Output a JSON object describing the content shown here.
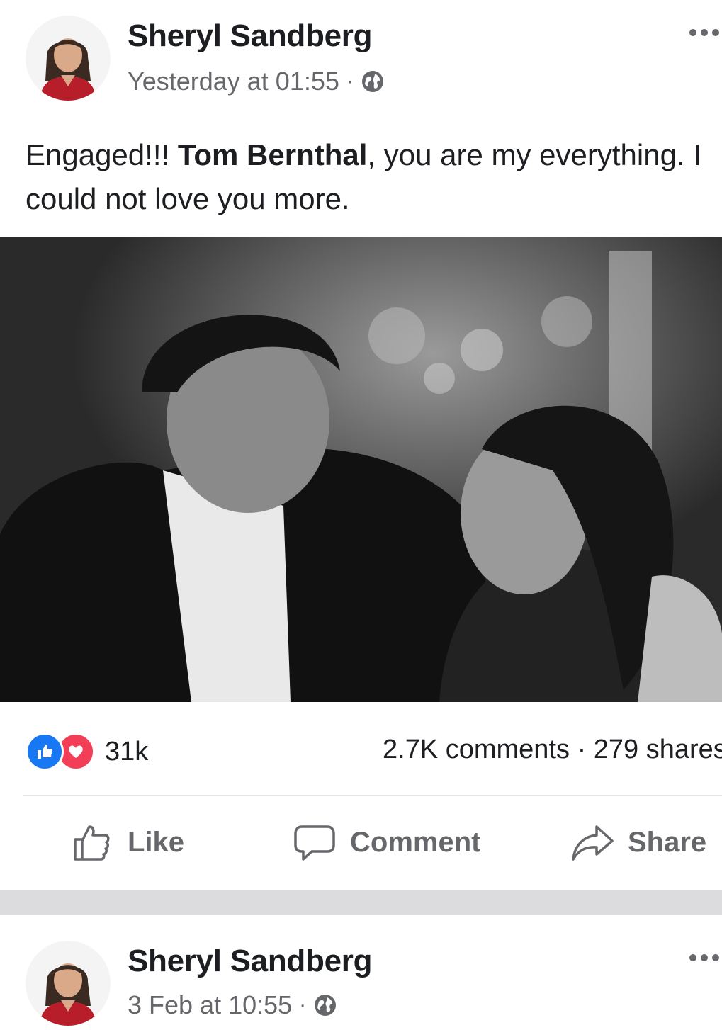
{
  "posts": [
    {
      "author": "Sheryl Sandberg",
      "time": "Yesterday at 01:55",
      "separator": "·",
      "text_part1": "Engaged!!! ",
      "text_mention": "Tom Bernthal",
      "text_part2": ", you are my everything. I could not love you more.",
      "reaction_count": "31k",
      "comments": "2.7K comments",
      "stats_separator": "·",
      "shares": "279 shares",
      "actions": {
        "like": "Like",
        "comment": "Comment",
        "share": "Share"
      }
    },
    {
      "author": "Sheryl Sandberg",
      "time": "3 Feb at 10:55",
      "separator": "·"
    }
  ],
  "colors": {
    "like_blue": "#1877f2",
    "love_red": "#f33e58",
    "secondary_text": "#65676b",
    "separator_gray": "#dcdcdf"
  },
  "icons": [
    "more-icon",
    "globe-icon",
    "like-reaction-icon",
    "love-reaction-icon",
    "thumbs-up-icon",
    "comment-icon",
    "share-icon"
  ]
}
